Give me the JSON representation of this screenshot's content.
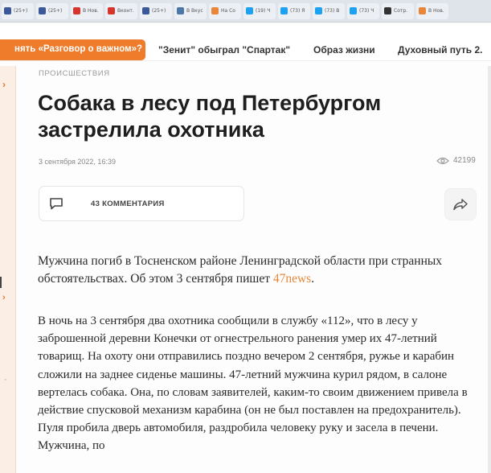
{
  "browser": {
    "tabs": [
      {
        "label": "(25+)",
        "color": "#3b5998"
      },
      {
        "label": "(25+)",
        "color": "#3b5998"
      },
      {
        "label": "В Нов.",
        "color": "#d9342b"
      },
      {
        "label": "Вконт.",
        "color": "#d9342b"
      },
      {
        "label": "(25+)",
        "color": "#3b5998"
      },
      {
        "label": "В Вкус",
        "color": "#4a76a8"
      },
      {
        "label": "На Со",
        "color": "#e8873a"
      },
      {
        "label": "(19) Ч",
        "color": "#1da1f2"
      },
      {
        "label": "(73) Я",
        "color": "#1da1f2"
      },
      {
        "label": "(73) В",
        "color": "#1da1f2"
      },
      {
        "label": "(73) Ч",
        "color": "#1da1f2"
      },
      {
        "label": "Сотр.",
        "color": "#333333"
      },
      {
        "label": "В Нов.",
        "color": "#e8873a"
      }
    ]
  },
  "nav": {
    "promo": "нять «Разговор о важном»?",
    "items": [
      "\"Зенит\" обыграл \"Спартак\"",
      "Образ жизни",
      "Духовный путь 2."
    ]
  },
  "article": {
    "rubric": "ПРОИСШЕСТВИЯ",
    "title": "Собака в лесу под Петербургом застрелила охотника",
    "date": "3 сентября 2022, 16:39",
    "views": "42199",
    "comments_label": "43 КОММЕНТАРИЯ",
    "lead_text": "Мужчина погиб в Тосненском районе Ленинградской области при странных обстоятельствах. Об этом 3 сентября пишет ",
    "lead_link": "47news",
    "lead_end": ".",
    "body": "В ночь на 3 сентября два охотника сообщили в службу «112», что в лесу у заброшенной деревни Конечки от огнестрельного ранения умер их 47-летний товарищ. На охоту они отправились поздно вечером 2 сентября, ружье и карабин сложили на заднее сиденье машины. 47-летний мужчина курил рядом, в салоне вертелась собака. Она, по словам заявителей, каким-то своим движением привела в действие спусковой механизм карабина (он не был поставлен на предохранитель). Пуля пробила дверь автомобиля, раздробила человеку руку и засела в печени. Мужчина, по"
  },
  "colors": {
    "accent": "#ef7c2a",
    "link": "#e8873a"
  },
  "icons": {
    "comment": "comment-icon",
    "share": "share-icon",
    "views": "eye-icon"
  }
}
